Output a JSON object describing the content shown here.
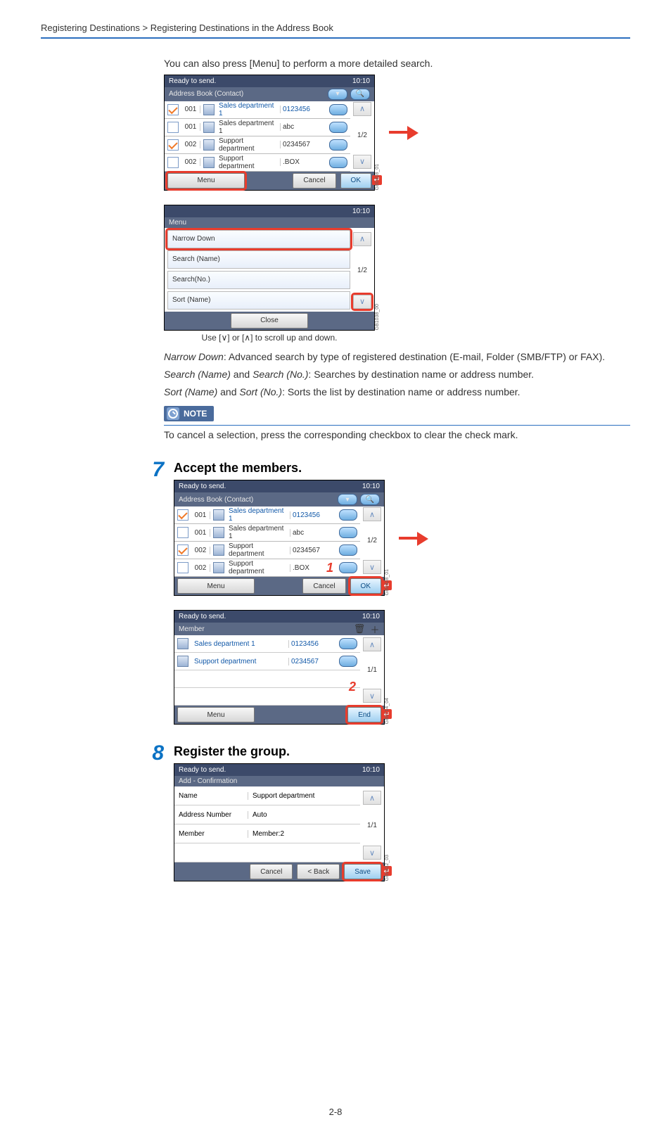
{
  "header": {
    "breadcrumb": "Registering Destinations > Registering Destinations in the Address Book"
  },
  "intro": {
    "pretext": "You can also press [Menu] to perform a more detailed search."
  },
  "screens": {
    "s6a": {
      "title_left": "Ready to send.",
      "title_right": "10:10",
      "subtitle": "Address Book (Contact)",
      "rows": [
        {
          "chk": true,
          "num": "001",
          "name": "Sales department 1",
          "val": "0123456",
          "name_blue": true,
          "val_blue": true
        },
        {
          "chk": false,
          "num": "001",
          "name": "Sales department 1",
          "val": "abc",
          "name_blue": false,
          "val_blue": false
        },
        {
          "chk": true,
          "num": "002",
          "name": "Support department",
          "val": "0234567",
          "name_blue": false,
          "val_blue": false
        },
        {
          "chk": false,
          "num": "002",
          "name": "Support department",
          "val": ".BOX",
          "name_blue": false,
          "val_blue": false
        }
      ],
      "page": "1/2",
      "btn_menu": "Menu",
      "btn_cancel": "Cancel",
      "btn_ok": "OK",
      "imgtag": "GB0428_01"
    },
    "s6b": {
      "title_right": "10:10",
      "subtitle": "Menu",
      "items": [
        "Narrow Down",
        "Search (Name)",
        "Search(No.)",
        "Sort (Name)"
      ],
      "page": "1/2",
      "btn_close": "Close",
      "imgtag": "GB1038_00",
      "caption": "Use [∨] or [∧] to scroll up and down."
    },
    "s7a": {
      "title_left": "Ready to send.",
      "title_right": "10:10",
      "subtitle": "Address Book (Contact)",
      "rows": [
        {
          "chk": true,
          "num": "001",
          "name": "Sales department 1",
          "val": "0123456",
          "name_blue": true,
          "val_blue": true
        },
        {
          "chk": false,
          "num": "001",
          "name": "Sales department 1",
          "val": "abc",
          "name_blue": false,
          "val_blue": false
        },
        {
          "chk": true,
          "num": "002",
          "name": "Support department",
          "val": "0234567",
          "name_blue": false,
          "val_blue": false
        },
        {
          "chk": false,
          "num": "002",
          "name": "Support department",
          "val": ".BOX",
          "name_blue": false,
          "val_blue": false
        }
      ],
      "page": "1/2",
      "btn_menu": "Menu",
      "btn_cancel": "Cancel",
      "btn_ok": "OK",
      "callout1": "1",
      "imgtag": "GB0428_01"
    },
    "s7b": {
      "title_left": "Ready to send.",
      "title_right": "10:10",
      "subtitle": "Member",
      "rows": [
        {
          "name": "Sales department 1",
          "val": "0123456"
        },
        {
          "name": "Support department",
          "val": "0234567"
        }
      ],
      "page": "1/1",
      "btn_menu": "Menu",
      "btn_end": "End",
      "callout2": "2",
      "imgtag": "GB0714_04"
    },
    "s8": {
      "title_left": "Ready to send.",
      "title_right": "10:10",
      "subtitle": "Add - Confirmation",
      "rows": [
        {
          "lbl": "Name",
          "val": "Support department"
        },
        {
          "lbl": "Address Number",
          "val": "Auto"
        },
        {
          "lbl": "Member",
          "val": "Member:2"
        }
      ],
      "page": "1/1",
      "btn_cancel": "Cancel",
      "btn_back": "< Back",
      "btn_save": "Save",
      "imgtag": "GB0432_03"
    }
  },
  "notes": {
    "narrow": ": Advanced search by type of registered destination (E-mail, Folder (SMB/FTP) or FAX).",
    "narrow_it": "Narrow Down",
    "search": ": Searches by destination name or address number.",
    "search_it1": "Search (Name)",
    "search_and": " and ",
    "search_it2": "Search (No.)",
    "sort": ": Sorts the list by destination name or address number.",
    "sort_it1": "Sort (Name)",
    "sort_it2": "Sort (No.)",
    "note_label": "NOTE",
    "note_text": "To cancel a selection, press the corresponding checkbox to clear the check mark."
  },
  "steps": {
    "s7": {
      "num": "7",
      "title": "Accept the members."
    },
    "s8": {
      "num": "8",
      "title": "Register the group."
    }
  },
  "footer": {
    "pagenum": "2-8"
  }
}
